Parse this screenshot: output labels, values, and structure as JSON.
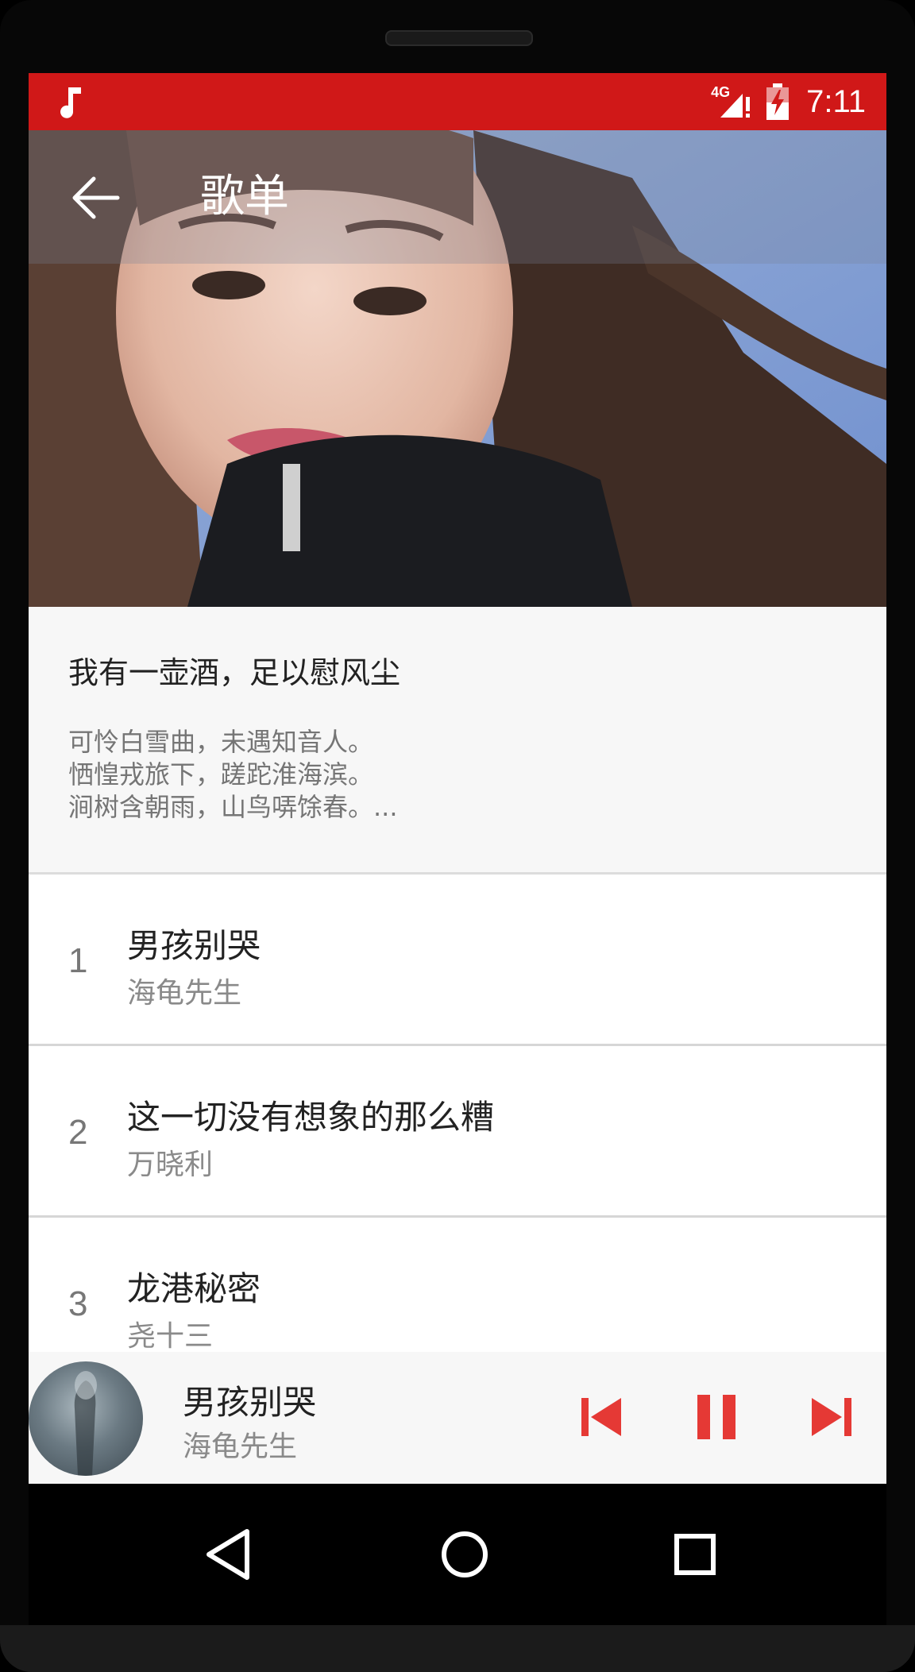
{
  "status_bar": {
    "network": "4G",
    "time": "7:11",
    "background": "#d01818",
    "icons": [
      "music-note-icon",
      "signal-icon",
      "battery-charging-icon"
    ]
  },
  "toolbar": {
    "title": "歌单",
    "back_icon": "arrow-back-icon"
  },
  "playlist": {
    "title": "我有一壶酒，足以慰风尘",
    "description": "可怜白雪曲，未遇知音人。\n恓惶戎旅下，蹉跎淮海滨。\n涧树含朝雨，山鸟哢馀春。..."
  },
  "songs": [
    {
      "index": "1",
      "title": "男孩别哭",
      "artist": "海龟先生"
    },
    {
      "index": "2",
      "title": "这一切没有想象的那么糟",
      "artist": "万晓利"
    },
    {
      "index": "3",
      "title": "龙港秘密",
      "artist": "尧十三"
    }
  ],
  "player": {
    "title": "男孩别哭",
    "artist": "海龟先生",
    "accent": "#e53935",
    "controls": [
      "skip-previous-icon",
      "pause-icon",
      "skip-next-icon"
    ]
  },
  "nav_bar": {
    "buttons": [
      "back-triangle-icon",
      "home-circle-icon",
      "recents-square-icon"
    ]
  }
}
